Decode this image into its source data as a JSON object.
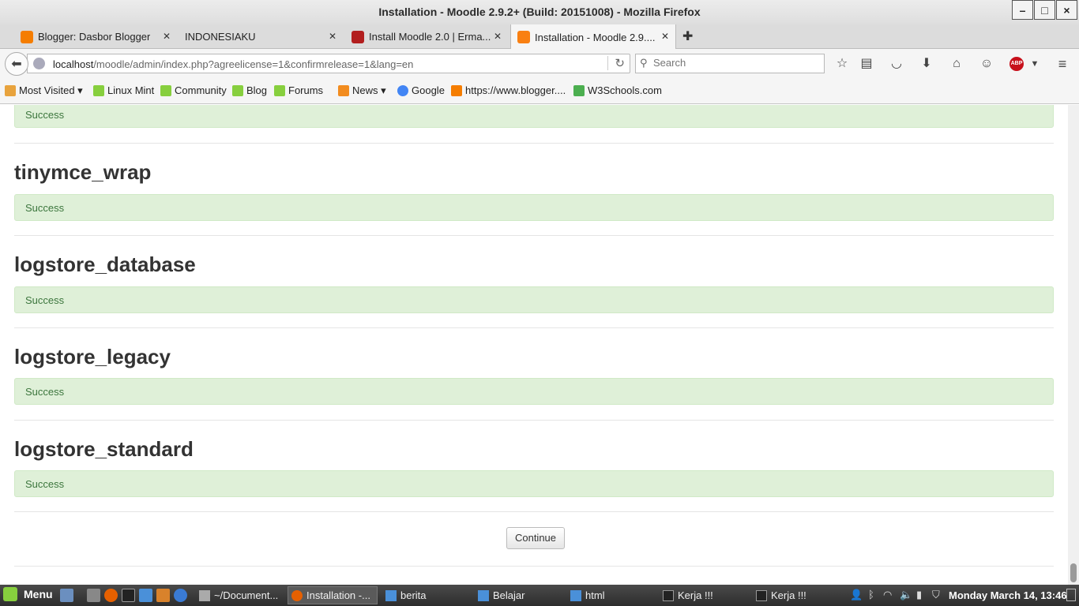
{
  "window": {
    "title": "Installation - Moodle 2.9.2+ (Build: 20151008) - Mozilla Firefox",
    "minimize": "–",
    "maximize": "□",
    "close": "×"
  },
  "tabs": [
    {
      "label": "Blogger: Dasbor Blogger",
      "icon": "blogger-icon",
      "color": "#f57d00"
    },
    {
      "label": "INDONESIAKU",
      "icon": "blank-page-icon",
      "color": "#dcdcdc"
    },
    {
      "label": "Install Moodle 2.0 | Erma...",
      "icon": "site-favicon",
      "color": "#b21e1e"
    },
    {
      "label": "Installation - Moodle 2.9....",
      "icon": "moodle-icon",
      "color": "#f98012"
    }
  ],
  "navbar": {
    "url_host": "localhost",
    "url_path": "/moodle/admin/index.php?agreelicense=1&confirmrelease=1&lang=en",
    "search_placeholder": "Search"
  },
  "bookmarks": [
    {
      "label": "Most Visited ▾",
      "icon": "most-visited-icon",
      "color": "#e8a33d"
    },
    {
      "label": "Linux Mint",
      "icon": "linux-mint-icon",
      "color": "#87cf3e"
    },
    {
      "label": "Community",
      "icon": "linux-mint-icon",
      "color": "#87cf3e"
    },
    {
      "label": "Blog",
      "icon": "linux-mint-icon",
      "color": "#87cf3e"
    },
    {
      "label": "Forums",
      "icon": "linux-mint-icon",
      "color": "#87cf3e"
    },
    {
      "label": "News ▾",
      "icon": "rss-icon",
      "color": "#f28c1f"
    },
    {
      "label": "Google",
      "icon": "google-icon",
      "color": "#4285f4"
    },
    {
      "label": "https://www.blogger....",
      "icon": "blogger-icon",
      "color": "#f57d00"
    },
    {
      "label": "W3Schools.com",
      "icon": "w3schools-icon",
      "color": "#4caf50"
    }
  ],
  "content": {
    "first_status": "Success",
    "plugins": [
      {
        "name": "tinymce_wrap",
        "status": "Success"
      },
      {
        "name": "logstore_database",
        "status": "Success"
      },
      {
        "name": "logstore_legacy",
        "status": "Success"
      },
      {
        "name": "logstore_standard",
        "status": "Success"
      }
    ],
    "continue_label": "Continue"
  },
  "taskbar": {
    "menu_label": "Menu",
    "tasks": [
      {
        "label": "~/Document...",
        "icon": "file-manager-icon"
      },
      {
        "label": "Installation -...",
        "icon": "firefox-icon"
      },
      {
        "label": "berita",
        "icon": "folder-icon"
      },
      {
        "label": "Belajar",
        "icon": "folder-icon"
      },
      {
        "label": "html",
        "icon": "folder-icon"
      },
      {
        "label": "Kerja !!!",
        "icon": "terminal-icon"
      },
      {
        "label": "Kerja !!!",
        "icon": "terminal-icon"
      }
    ],
    "clock": "Monday March 14, 13:46"
  }
}
